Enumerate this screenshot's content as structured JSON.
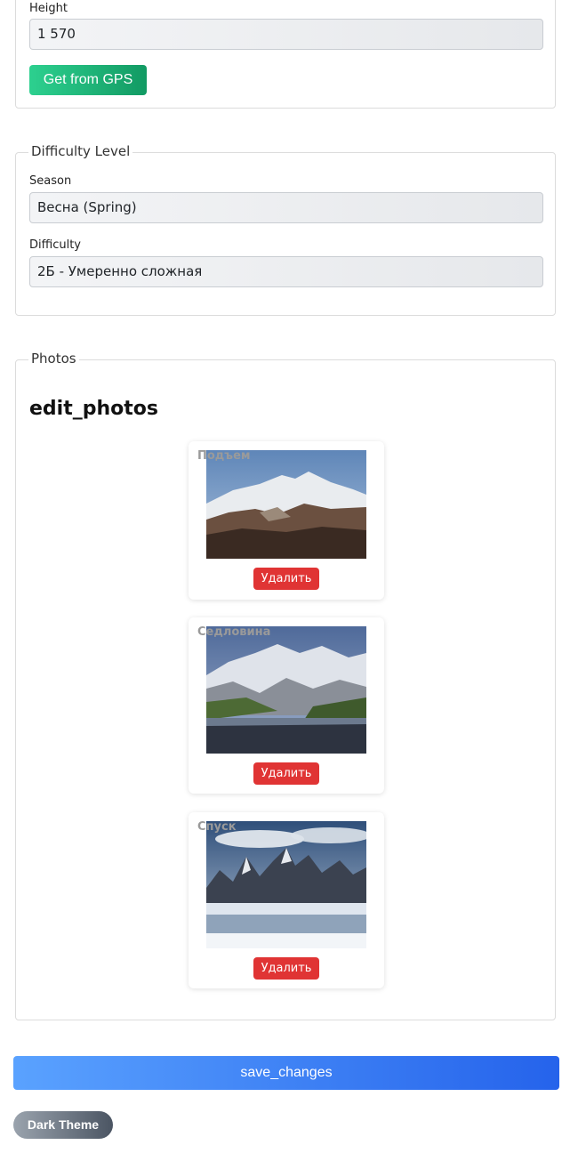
{
  "location": {
    "height_label": "Height",
    "height_value": "1 570",
    "gps_button": "Get from GPS"
  },
  "difficulty": {
    "legend": "Difficulty Level",
    "season_label": "Season",
    "season_value": "Весна (Spring)",
    "difficulty_label": "Difficulty",
    "difficulty_value": "2Б - Умеренно сложная"
  },
  "photos": {
    "legend": "Photos",
    "title": "edit_photos",
    "items": [
      {
        "caption": "Подъем",
        "delete_label": "Удалить",
        "image": "snowy-ridge-photo"
      },
      {
        "caption": "Седловина",
        "delete_label": "Удалить",
        "image": "glacier-lake-photo"
      },
      {
        "caption": "Спуск",
        "delete_label": "Удалить",
        "image": "jagged-peaks-lake-photo"
      }
    ]
  },
  "actions": {
    "save_label": "save_changes",
    "theme_label": "Dark Theme"
  },
  "colors": {
    "gps_green": "#129a63",
    "delete_red": "#e03434",
    "save_blue": "#2563eb",
    "theme_gray": "#4b5563"
  }
}
